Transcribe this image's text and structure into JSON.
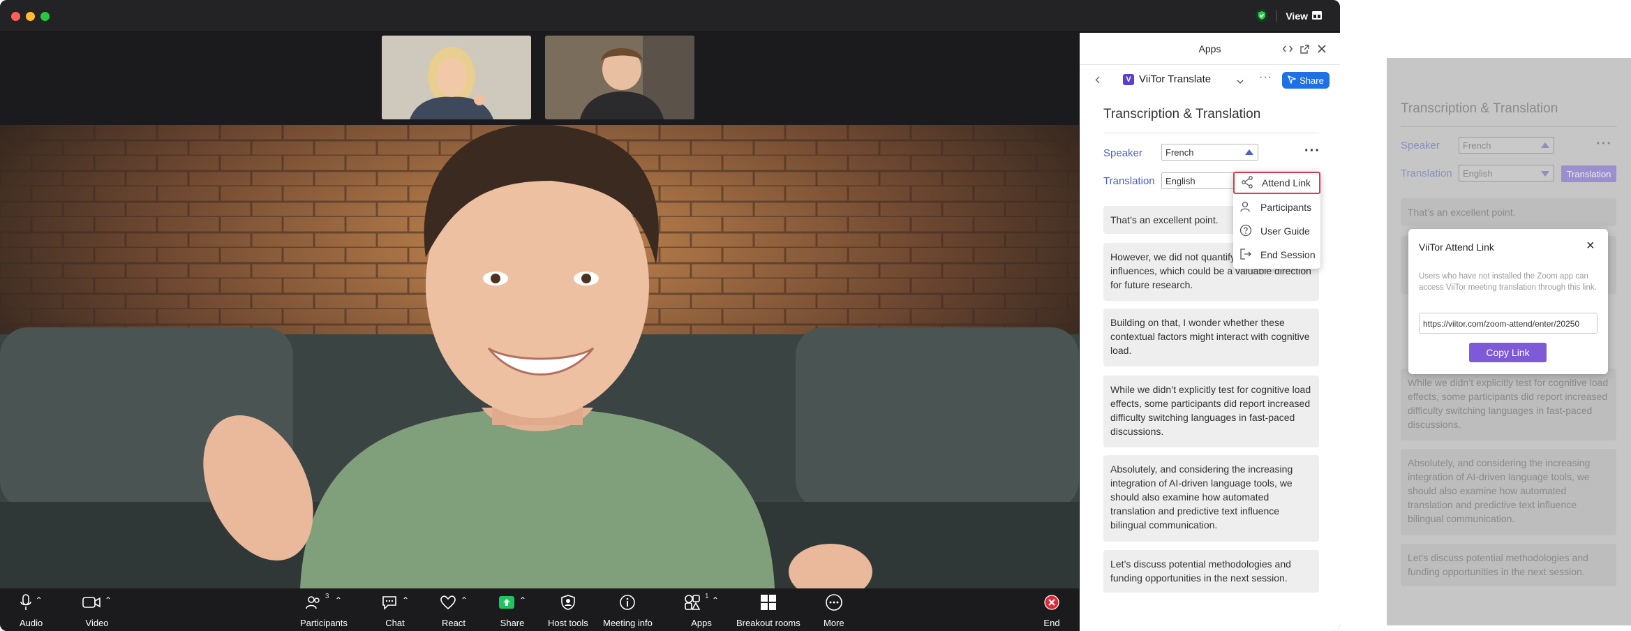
{
  "window": {
    "view_label": "View"
  },
  "toolbar": {
    "audio": "Audio",
    "video": "Video",
    "participants": "Participants",
    "participants_count": "3",
    "chat": "Chat",
    "react": "React",
    "share": "Share",
    "host_tools": "Host tools",
    "meeting_info": "Meeting info",
    "apps": "Apps",
    "apps_count": "1",
    "breakout_rooms": "Breakout rooms",
    "more": "More",
    "end": "End"
  },
  "apps_panel": {
    "title": "Apps",
    "app_logo": "V",
    "app_name": "ViiTor Translate",
    "share_label": "Share",
    "section_title": "Transcription & Translation",
    "speaker_label": "Speaker",
    "speaker_value": "French",
    "translation_label": "Translation",
    "translation_value": "English",
    "menu": {
      "attend_link": "Attend Link",
      "participants": "Participants",
      "user_guide": "User Guide",
      "end_session": "End Session"
    },
    "messages": [
      "That’s an excellent point.",
      "However, we did not quantify these external influences, which could be a valuable direction for future research.",
      "Building on that, I wonder whether these contextual factors might interact with cognitive load.",
      "While we didn’t explicitly test for cognitive load effects, some participants did report increased difficulty switching languages in fast-paced discussions.",
      "Absolutely, and considering the increasing integration of AI-driven language tools, we should also examine how automated translation and predictive text influence bilingual communication.",
      "Let’s discuss potential methodologies and funding opportunities in the next session."
    ]
  },
  "ghost_panel": {
    "section_title": "Transcription & Translation",
    "speaker_label": "Speaker",
    "speaker_value": "French",
    "translation_label": "Translation",
    "translation_value": "English",
    "translation_button": "Translation",
    "messages": [
      "That’s an excellent point.",
      "While we didn’t explicitly test for cognitive load effects, some participants did report increased difficulty switching languages in fast-paced discussions.",
      "Absolutely, and considering the increasing integration of AI-driven language tools, we should also examine how automated translation and predictive text influence bilingual communication.",
      "Let’s discuss potential methodologies and funding opportunities in the next session."
    ],
    "modal": {
      "title": "ViiTor Attend Link",
      "close": "×",
      "description": "Users who have not installed the Zoom app can access ViiTor meeting translation through this link.",
      "link_value": "https://viitor.com/zoom-attend/enter/20250",
      "copy_label": "Copy Link"
    }
  }
}
